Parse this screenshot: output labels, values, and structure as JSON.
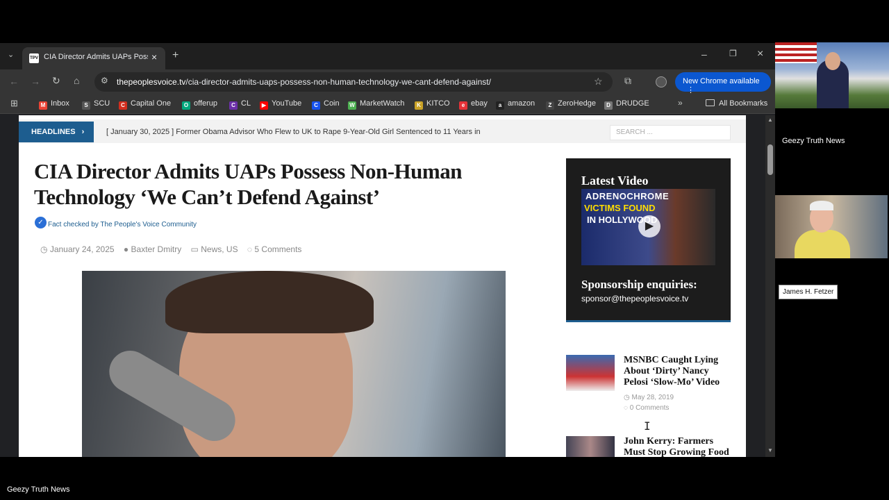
{
  "browser": {
    "tab_title": "CIA Director Admits UAPs Possess Non-Human Technology",
    "tab_favicon": "TPV",
    "url_domain": "thepeoplesvoice.tv",
    "url_path": "/cia-director-admits-uaps-possess-non-human-technology-we-cant-defend-against/",
    "new_chrome": "New Chrome available",
    "bookmarks": [
      {
        "label": "Inbox",
        "color": "#ea4335",
        "glyph": "M"
      },
      {
        "label": "SCU",
        "color": "#555555",
        "glyph": "S"
      },
      {
        "label": "Capital One",
        "color": "#d22e1e",
        "glyph": "C"
      },
      {
        "label": "offerup",
        "color": "#00a87e",
        "glyph": "O"
      },
      {
        "label": "CL",
        "color": "#6b2fa8",
        "glyph": "C"
      },
      {
        "label": "YouTube",
        "color": "#ff0000",
        "glyph": "▶"
      },
      {
        "label": "Coin",
        "color": "#1652f0",
        "glyph": "C"
      },
      {
        "label": "MarketWatch",
        "color": "#4caf50",
        "glyph": "W"
      },
      {
        "label": "KITCO",
        "color": "#c9a227",
        "glyph": "K"
      },
      {
        "label": "ebay",
        "color": "#e53238",
        "glyph": "e"
      },
      {
        "label": "amazon",
        "color": "#222222",
        "glyph": "a"
      },
      {
        "label": "ZeroHedge",
        "color": "#444444",
        "glyph": "Z"
      },
      {
        "label": "DRUDGE",
        "color": "#777777",
        "glyph": "D"
      }
    ],
    "all_bookmarks": "All Bookmarks"
  },
  "site": {
    "headlines_label": "HEADLINES",
    "ticker": "[ January 30, 2025 ]  Former Obama Advisor Who Flew to UK to Rape 9-Year-Old Girl Sentenced to 11 Years in",
    "search_placeholder": "SEARCH ...",
    "article": {
      "title": "CIA Director Admits UAPs Possess Non-Human Technology ‘We Can’t Defend Against’",
      "fact_check": "Fact checked by The People's Voice Community",
      "date": "January 24, 2025",
      "author": "Baxter Dmitry",
      "categories": "News, US",
      "comments": "5 Comments"
    },
    "sidebar": {
      "latest_video": "Latest Video",
      "thumb_line1": "ADRENOCHROME",
      "thumb_line2": "VICTIMS FOUND",
      "thumb_line3": "IN HOLLYWOOD",
      "sponsorship_heading": "Sponsorship enquiries:",
      "sponsorship_email": "sponsor@thepeoplesvoice.tv",
      "posts": [
        {
          "title": "MSNBC Caught Lying About ‘Dirty’ Nancy Pelosi ‘Slow-Mo’ Video",
          "date": "May 28, 2019",
          "comments": "0 Comments"
        },
        {
          "title": "John Kerry: Farmers Must Stop Growing Food In",
          "date": "",
          "comments": ""
        }
      ]
    }
  },
  "stream": {
    "channel_name": "Geezy Truth News",
    "guest_name": "James H. Fetzer",
    "bottom_brand": "Geezy Truth News"
  }
}
